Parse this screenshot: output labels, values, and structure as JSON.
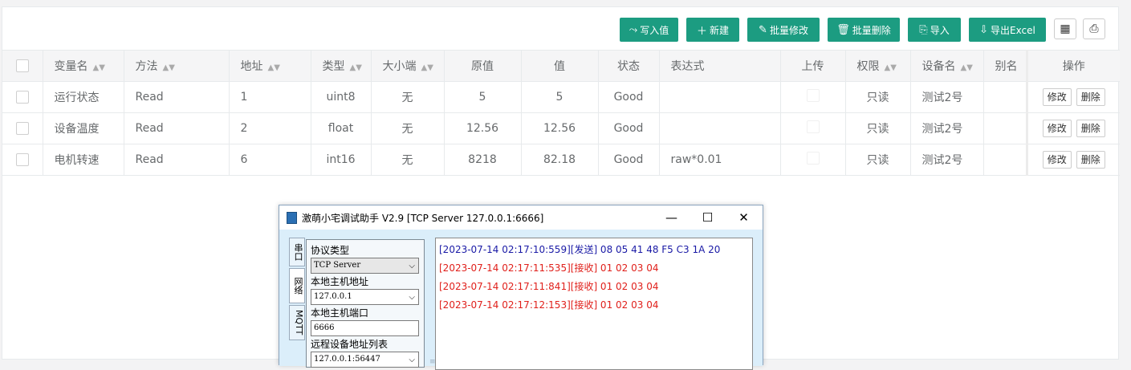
{
  "toolbar": {
    "write_value": "写入值",
    "new": "新建",
    "batch_edit": "批量修改",
    "batch_delete": "批量删除",
    "import": "导入",
    "export_excel": "导出Excel"
  },
  "table": {
    "headers": [
      "变量名",
      "方法",
      "地址",
      "类型",
      "大小端",
      "原值",
      "值",
      "状态",
      "表达式",
      "上传",
      "权限",
      "设备名",
      "别名",
      "操作"
    ],
    "rows": [
      {
        "name": "运行状态",
        "method": "Read",
        "address": "1",
        "type": "uint8",
        "endian": "无",
        "raw": "5",
        "value": "5",
        "status": "Good",
        "expression": "",
        "permission": "只读",
        "device": "测试2号",
        "alias": ""
      },
      {
        "name": "设备温度",
        "method": "Read",
        "address": "2",
        "type": "float",
        "endian": "无",
        "raw": "12.56",
        "value": "12.56",
        "status": "Good",
        "expression": "",
        "permission": "只读",
        "device": "测试2号",
        "alias": ""
      },
      {
        "name": "电机转速",
        "method": "Read",
        "address": "6",
        "type": "int16",
        "endian": "无",
        "raw": "8218",
        "value": "82.18",
        "status": "Good",
        "expression": "raw*0.01",
        "permission": "只读",
        "device": "测试2号",
        "alias": ""
      }
    ],
    "edit_label": "修改",
    "delete_label": "删除"
  },
  "dialog": {
    "title": "激萌小宅调试助手 V2.9  [TCP Server 127.0.0.1:6666]",
    "tabs": [
      "串口",
      "网络",
      "MQTT"
    ],
    "protocol_label": "协议类型",
    "protocol_value": "TCP Server",
    "local_host_label": "本地主机地址",
    "local_host_value": "127.0.0.1",
    "local_port_label": "本地主机端口",
    "local_port_value": "6666",
    "remote_list_label": "远程设备地址列表",
    "remote_list_value": "127.0.0.1:56447",
    "log": [
      {
        "text": "[2023-07-14 02:17:10:559][发送] 08 05 41 48 F5 C3 1A 20",
        "color": "#1a1aa6"
      },
      {
        "text": "[2023-07-14 02:17:11:535][接收] 01 02 03 04",
        "color": "#e0201b"
      },
      {
        "text": "[2023-07-14 02:17:11:841][接收] 01 02 03 04",
        "color": "#e0201b"
      },
      {
        "text": "[2023-07-14 02:17:12:153][接收] 01 02 03 04",
        "color": "#e0201b"
      }
    ]
  },
  "colors": {
    "accent": "#1c9c81",
    "send": "#1a1aa6",
    "receive": "#e0201b"
  }
}
